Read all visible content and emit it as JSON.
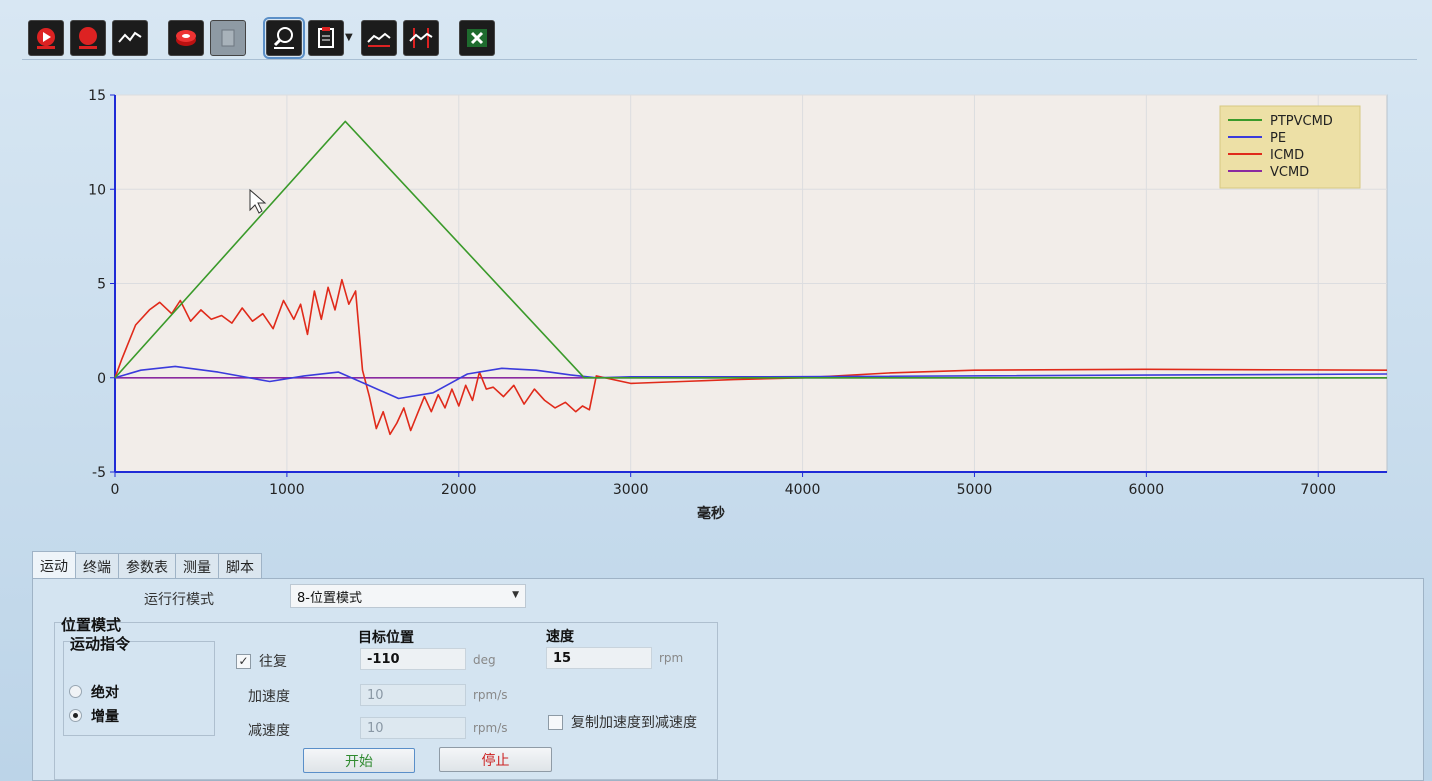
{
  "toolbar": {
    "buttons": [
      {
        "name": "run-icon"
      },
      {
        "name": "record-icon"
      },
      {
        "name": "wave-icon"
      },
      {
        "name": "disk-icon"
      },
      {
        "name": "stop-square-icon"
      },
      {
        "name": "zoom-icon"
      },
      {
        "name": "clipboard-icon"
      },
      {
        "name": "trace-icon"
      },
      {
        "name": "cursor-trace-icon"
      },
      {
        "name": "excel-icon"
      }
    ]
  },
  "chart_data": {
    "type": "line",
    "xlabel": "毫秒",
    "ylabel": "",
    "xlim": [
      0,
      7400
    ],
    "ylim": [
      -5,
      15
    ],
    "xticks": [
      "0",
      "1000",
      "2000",
      "3000",
      "4000",
      "5000",
      "6000",
      "7000"
    ],
    "yticks": [
      "15",
      "10",
      "5",
      "0",
      "-5"
    ],
    "legend_position": "top-right",
    "series": [
      {
        "name": "PTPVCMD",
        "color": "#3a9a2a",
        "x": [
          0,
          1340,
          2730,
          7400
        ],
        "y": [
          0,
          13.6,
          0,
          0
        ]
      },
      {
        "name": "PE",
        "color": "#3b3bdc",
        "x": [
          0,
          150,
          350,
          600,
          900,
          1100,
          1300,
          1450,
          1650,
          1850,
          2050,
          2250,
          2450,
          2650,
          2800,
          3000,
          3400,
          3800,
          7400
        ],
        "y": [
          0,
          0.4,
          0.6,
          0.3,
          -0.2,
          0.1,
          0.3,
          -0.3,
          -1.1,
          -0.8,
          0.2,
          0.5,
          0.4,
          0.15,
          0,
          0.05,
          0.05,
          0.05,
          0.2
        ]
      },
      {
        "name": "ICMD",
        "color": "#e02a1a",
        "x": [
          0,
          40,
          120,
          200,
          260,
          330,
          380,
          440,
          500,
          560,
          620,
          680,
          740,
          800,
          860,
          920,
          980,
          1040,
          1080,
          1120,
          1160,
          1200,
          1240,
          1280,
          1320,
          1360,
          1400,
          1440,
          1480,
          1520,
          1560,
          1600,
          1640,
          1680,
          1720,
          1760,
          1800,
          1840,
          1880,
          1920,
          1960,
          2000,
          2040,
          2080,
          2120,
          2160,
          2200,
          2260,
          2320,
          2380,
          2440,
          2500,
          2560,
          2620,
          2680,
          2720,
          2760,
          2800,
          3000,
          3300,
          3600,
          4000,
          4500,
          5000,
          6000,
          7400
        ],
        "y": [
          0,
          1.0,
          2.8,
          3.6,
          4.0,
          3.4,
          4.1,
          3.0,
          3.6,
          3.1,
          3.3,
          2.9,
          3.7,
          3.0,
          3.4,
          2.6,
          4.1,
          3.1,
          3.9,
          2.3,
          4.6,
          3.1,
          4.8,
          3.6,
          5.2,
          3.9,
          4.6,
          0.4,
          -1.0,
          -2.7,
          -1.8,
          -3.0,
          -2.4,
          -1.6,
          -2.8,
          -1.9,
          -1.0,
          -1.8,
          -0.9,
          -1.6,
          -0.6,
          -1.5,
          -0.4,
          -1.2,
          0.3,
          -0.6,
          -0.5,
          -1.0,
          -0.4,
          -1.4,
          -0.6,
          -1.2,
          -1.6,
          -1.3,
          -1.8,
          -1.5,
          -1.7,
          0.1,
          -0.3,
          -0.2,
          -0.1,
          0.0,
          0.25,
          0.4,
          0.45,
          0.4
        ]
      },
      {
        "name": "VCMD",
        "color": "#8a2aa0",
        "x": [
          0,
          7400
        ],
        "y": [
          0,
          0
        ]
      }
    ]
  },
  "tabs": [
    "运动",
    "终端",
    "参数表",
    "测量",
    "脚本"
  ],
  "run_mode": {
    "label": "运行行模式",
    "value": "8-位置模式"
  },
  "position_mode": {
    "title": "位置模式",
    "motion_cmd": "运动指令",
    "absolute": "绝对",
    "increment": "增量",
    "selected": "增量"
  },
  "fields": {
    "reciprocate_label": "往复",
    "reciprocate_checked": "✓",
    "target_header": "目标位置",
    "target_value": "-110",
    "target_unit": "deg",
    "speed_header": "速度",
    "speed_value": "15",
    "speed_unit": "rpm",
    "accel_label": "加速度",
    "accel_value": "10",
    "accel_unit": "rpm/s",
    "decel_label": "减速度",
    "decel_value": "10",
    "decel_unit": "rpm/s",
    "copy_label": "复制加速度到减速度"
  },
  "buttons": {
    "start": "开始",
    "stop": "停止"
  }
}
